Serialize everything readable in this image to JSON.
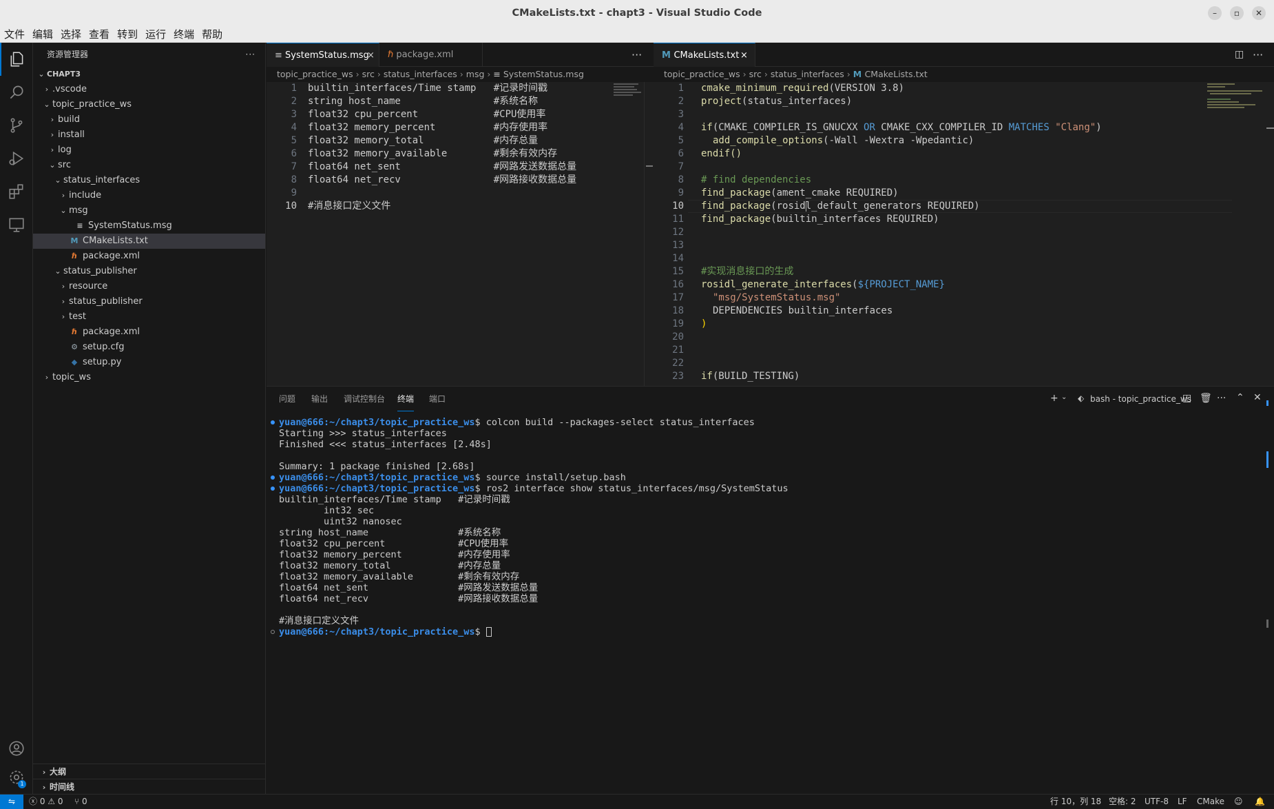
{
  "window": {
    "title": "CMakeLists.txt - chapt3 - Visual Studio Code"
  },
  "menu": [
    "文件",
    "编辑",
    "选择",
    "查看",
    "转到",
    "运行",
    "终端",
    "帮助"
  ],
  "sidebar": {
    "title": "资源管理器",
    "outline": "大纲",
    "timeline": "时间线",
    "tree": [
      {
        "label": "CHAPT3",
        "depth": 0,
        "type": "root",
        "open": true
      },
      {
        "label": ".vscode",
        "depth": 1,
        "type": "folder",
        "open": false
      },
      {
        "label": "topic_practice_ws",
        "depth": 1,
        "type": "folder",
        "open": true
      },
      {
        "label": "build",
        "depth": 2,
        "type": "folder",
        "open": false
      },
      {
        "label": "install",
        "depth": 2,
        "type": "folder",
        "open": false
      },
      {
        "label": "log",
        "depth": 2,
        "type": "folder",
        "open": false
      },
      {
        "label": "src",
        "depth": 2,
        "type": "folder",
        "open": true
      },
      {
        "label": "status_interfaces",
        "depth": 3,
        "type": "folder",
        "open": true
      },
      {
        "label": "include",
        "depth": 4,
        "type": "folder",
        "open": false
      },
      {
        "label": "msg",
        "depth": 4,
        "type": "folder",
        "open": true
      },
      {
        "label": "SystemStatus.msg",
        "depth": 5,
        "type": "msg"
      },
      {
        "label": "CMakeLists.txt",
        "depth": 4,
        "type": "cmake",
        "selected": true
      },
      {
        "label": "package.xml",
        "depth": 4,
        "type": "xml"
      },
      {
        "label": "status_publisher",
        "depth": 3,
        "type": "folder",
        "open": true
      },
      {
        "label": "resource",
        "depth": 4,
        "type": "folder",
        "open": false
      },
      {
        "label": "status_publisher",
        "depth": 4,
        "type": "folder",
        "open": false
      },
      {
        "label": "test",
        "depth": 4,
        "type": "folder",
        "open": false
      },
      {
        "label": "package.xml",
        "depth": 4,
        "type": "xml"
      },
      {
        "label": "setup.cfg",
        "depth": 4,
        "type": "cfg"
      },
      {
        "label": "setup.py",
        "depth": 4,
        "type": "py"
      },
      {
        "label": "topic_ws",
        "depth": 1,
        "type": "folder",
        "open": false
      }
    ]
  },
  "left_editor": {
    "tabs": [
      {
        "label": "SystemStatus.msg",
        "active": true
      },
      {
        "label": "package.xml",
        "active": false
      }
    ],
    "breadcrumb": [
      "topic_practice_ws",
      "src",
      "status_interfaces",
      "msg",
      "SystemStatus.msg"
    ],
    "lines": [
      "builtin_interfaces/Time stamp   #记录时间戳",
      "string host_name                #系统名称",
      "float32 cpu_percent             #CPU使用率",
      "float32 memory_percent          #内存使用率",
      "float32 memory_total            #内存总量",
      "float32 memory_available        #剩余有效内存",
      "float64 net_sent                #网路发送数据总量",
      "float64 net_recv                #网路接收数据总量",
      "",
      "#消息接口定义文件"
    ],
    "current_line": 10
  },
  "right_editor": {
    "tabs": [
      {
        "label": "CMakeLists.txt",
        "active": true
      }
    ],
    "breadcrumb": [
      "topic_practice_ws",
      "src",
      "status_interfaces",
      "CMakeLists.txt"
    ],
    "line_numbers": [
      "1",
      "2",
      "3",
      "4",
      "5",
      "6",
      "7",
      "8",
      "9",
      "10",
      "11",
      "12",
      "13",
      "14",
      "15",
      "16",
      "17",
      "18",
      "19",
      "20",
      "21",
      "22",
      "23"
    ],
    "current_line": 10,
    "code": {
      "l1_fn": "cmake_minimum_required",
      "l1_rest": "(VERSION 3.8)",
      "l2_fn": "project",
      "l2_rest": "(status_interfaces)",
      "l4_if": "if",
      "l4_a": "(CMAKE_COMPILER_IS_GNUCXX ",
      "l4_or": "OR",
      "l4_b": " CMAKE_CXX_COMPILER_ID ",
      "l4_matches": "MATCHES",
      "l4_str": " \"Clang\"",
      "l4_end": ")",
      "l5_fn": "add_compile_options",
      "l5_rest": "(-Wall -Wextra -Wpedantic)",
      "l6": "endif()",
      "l8": "# find dependencies",
      "l9_fn": "find_package",
      "l9_rest": "(ament_cmake REQUIRED)",
      "l10_fn": "find_package",
      "l10_rest": "(rosidl_default_generators REQUIRED)",
      "l11_fn": "find_package",
      "l11_rest": "(builtin_interfaces REQUIRED)",
      "l15": "#实现消息接口的生成",
      "l16_fn": "rosidl_generate_interfaces",
      "l16_open": "(",
      "l16_var": "${PROJECT_NAME}",
      "l17": "\"msg/SystemStatus.msg\"",
      "l18": "DEPENDENCIES builtin_interfaces",
      "l19": ")",
      "l23_fn": "if",
      "l23_rest": "(BUILD_TESTING)"
    }
  },
  "panel": {
    "tabs": [
      "问题",
      "输出",
      "调试控制台",
      "终端",
      "端口"
    ],
    "active_tab": "终端",
    "terminal_name": "bash - topic_practice_ws",
    "prompt_user": "yuan@666",
    "prompt_path": ":~/chapt3/topic_practice_ws",
    "lines": [
      {
        "type": "cmd",
        "dot": "blue",
        "cmd": "$ colcon build --packages-select status_interfaces"
      },
      {
        "type": "out",
        "text": "Starting >>> status_interfaces"
      },
      {
        "type": "out",
        "text": "Finished <<< status_interfaces [2.48s]"
      },
      {
        "type": "out",
        "text": ""
      },
      {
        "type": "out",
        "text": "Summary: 1 package finished [2.68s]"
      },
      {
        "type": "cmd",
        "dot": "blue",
        "cmd": "$ source install/setup.bash"
      },
      {
        "type": "cmd",
        "dot": "blue",
        "cmd": "$ ros2 interface show status_interfaces/msg/SystemStatus"
      },
      {
        "type": "out",
        "text": "builtin_interfaces/Time stamp   #记录时间戳"
      },
      {
        "type": "out",
        "text": "        int32 sec"
      },
      {
        "type": "out",
        "text": "        uint32 nanosec"
      },
      {
        "type": "out",
        "text": "string host_name                #系统名称"
      },
      {
        "type": "out",
        "text": "float32 cpu_percent             #CPU使用率"
      },
      {
        "type": "out",
        "text": "float32 memory_percent          #内存使用率"
      },
      {
        "type": "out",
        "text": "float32 memory_total            #内存总量"
      },
      {
        "type": "out",
        "text": "float32 memory_available        #剩余有效内存"
      },
      {
        "type": "out",
        "text": "float64 net_sent                #网路发送数据总量"
      },
      {
        "type": "out",
        "text": "float64 net_recv                #网路接收数据总量"
      },
      {
        "type": "out",
        "text": ""
      },
      {
        "type": "out",
        "text": "#消息接口定义文件"
      },
      {
        "type": "cmd",
        "dot": "hollow",
        "cmd": "$ "
      }
    ]
  },
  "status": {
    "errors": "0",
    "warnings": "0",
    "ports": "0",
    "position": "行 10，列 18",
    "indent": "空格: 2",
    "encoding": "UTF-8",
    "eol": "LF",
    "language": "CMake"
  },
  "colors": {
    "accent": "#0078d4",
    "editor_bg": "#1f1f1f",
    "side_bg": "#181818",
    "prompt": "#3b8eea"
  }
}
